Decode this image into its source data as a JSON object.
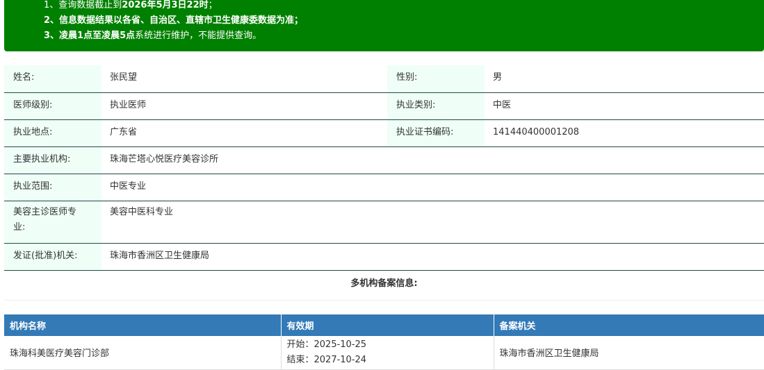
{
  "notice": {
    "line1_prefix": "1、查询数据截止到",
    "line1_bold": "2026年5月3日22时",
    "line1_suffix": "；",
    "line2": "2、信息数据结果以各省、自治区、直辖市卫生健康委数据为准；",
    "line3_bold": "3、凌晨1点至凌晨5点",
    "line3_suffix": "系统进行维护，不能提供查询。"
  },
  "doctor": {
    "name_label": "姓名:",
    "name": "张民望",
    "gender_label": "性别:",
    "gender": "男",
    "level_label": "医师级别:",
    "level": "执业医师",
    "category_label": "执业类别:",
    "category": "中医",
    "location_label": "执业地点:",
    "location": "广东省",
    "cert_label": "执业证书编码:",
    "cert": "141440400001208",
    "institution_label": "主要执业机构:",
    "institution": "珠海芒塔心悦医疗美容诊所",
    "scope_label": "执业范围:",
    "scope": "中医专业",
    "beauty_label": "美容主诊医师专业:",
    "beauty": "美容中医科专业",
    "issuer_label": "发证(批准)机关:",
    "issuer": "珠海市香洲区卫生健康局"
  },
  "multi_record": {
    "title": "多机构备案信息:",
    "headers": [
      "机构名称",
      "有效期",
      "备案机关"
    ],
    "rows": [
      {
        "institution": "珠海科美医疗美容门诊部",
        "start": "开始：2025-10-25",
        "end": "结束：2027-10-24",
        "authority": "珠海市香洲区卫生健康局"
      }
    ]
  }
}
